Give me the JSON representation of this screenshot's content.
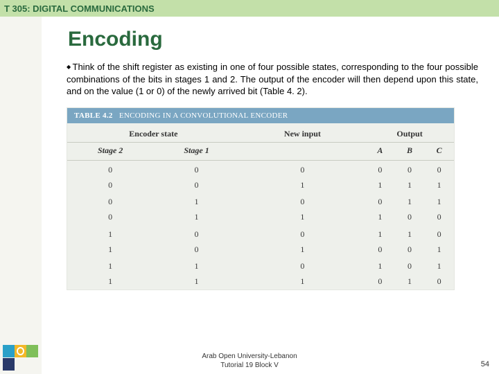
{
  "header": {
    "course": "T 305: DIGITAL COMMUNICATIONS"
  },
  "slide": {
    "title": "Encoding",
    "paragraph": "Think of the shift register as existing in one of four possible states, corresponding to the four possible combinations of the bits in stages 1 and 2. The output of the encoder will then depend upon this state, and on the value (1 or 0) of the newly arrived bit (Table 4. 2)."
  },
  "table": {
    "caption_num": "TABLE 4.2",
    "caption_txt": "ENCODING IN A CONVOLUTIONAL ENCODER",
    "group_headers": [
      "Encoder state",
      "New input",
      "Output"
    ],
    "sub_headers": [
      "Stage 2",
      "Stage 1",
      "",
      "A",
      "B",
      "C"
    ],
    "rows": [
      [
        "0",
        "0",
        "0",
        "0",
        "0",
        "0"
      ],
      [
        "0",
        "0",
        "1",
        "1",
        "1",
        "1"
      ],
      [
        "0",
        "1",
        "0",
        "0",
        "1",
        "1"
      ],
      [
        "0",
        "1",
        "1",
        "1",
        "0",
        "0"
      ],
      [
        "1",
        "0",
        "0",
        "1",
        "1",
        "0"
      ],
      [
        "1",
        "0",
        "1",
        "0",
        "0",
        "1"
      ],
      [
        "1",
        "1",
        "0",
        "1",
        "0",
        "1"
      ],
      [
        "1",
        "1",
        "1",
        "0",
        "1",
        "0"
      ]
    ]
  },
  "footer": {
    "line1": "Arab Open University-Lebanon",
    "line2": "Tutorial 19 Block V",
    "page": "54"
  },
  "chart_data": {
    "type": "table",
    "title": "TABLE 4.2 ENCODING IN A CONVOLUTIONAL ENCODER",
    "columns": [
      "Stage 2",
      "Stage 1",
      "New input",
      "A",
      "B",
      "C"
    ],
    "rows": [
      [
        0,
        0,
        0,
        0,
        0,
        0
      ],
      [
        0,
        0,
        1,
        1,
        1,
        1
      ],
      [
        0,
        1,
        0,
        0,
        1,
        1
      ],
      [
        0,
        1,
        1,
        1,
        0,
        0
      ],
      [
        1,
        0,
        0,
        1,
        1,
        0
      ],
      [
        1,
        0,
        1,
        0,
        0,
        1
      ],
      [
        1,
        1,
        0,
        1,
        0,
        1
      ],
      [
        1,
        1,
        1,
        0,
        1,
        0
      ]
    ]
  }
}
